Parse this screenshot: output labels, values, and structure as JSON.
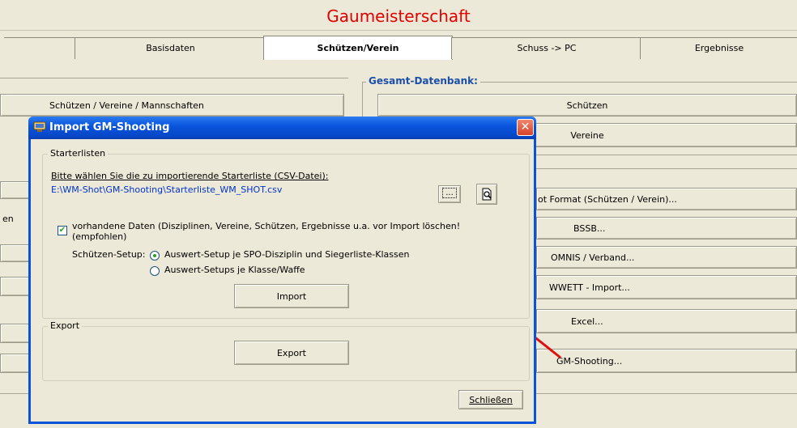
{
  "app": {
    "title": "Gaumeisterschaft",
    "tabs": [
      {
        "label": "Basisdaten"
      },
      {
        "label": "Schützen/Verein"
      },
      {
        "label": "Schuss -> PC"
      },
      {
        "label": "Ergebnisse"
      }
    ]
  },
  "left_panel": {
    "schuetzen_button": "Schützen / Vereine / Mannschaften",
    "partial_label": "en"
  },
  "right_panel": {
    "group_title": "Gesamt-Datenbank:",
    "buttons": {
      "schuetzen": "Schützen",
      "vereine": "Vereine",
      "format": "ot Format (Schützen / Verein)...",
      "bssb": "BSSB...",
      "omnis": "OMNIS / Verband...",
      "wwett": "WWETT - Import...",
      "excel": "Excel...",
      "gm_shooting": "GM-Shooting..."
    }
  },
  "dialog": {
    "title": "Import GM-Shooting",
    "close_glyph": "✕",
    "starterlisten": {
      "legend": "Starterlisten",
      "prompt": "Bitte wählen Sie die zu importierende Starterliste (CSV-Datei):",
      "path": "E:\\WM-Shot\\GM-Shooting\\Starterliste_WM_SHOT.csv",
      "browse_label": "...",
      "delete_checkbox": {
        "checked": true,
        "line1": "vorhandene Daten (Disziplinen, Vereine, Schützen, Ergebnisse u.a. vor Import löschen!",
        "line2": "(empfohlen)"
      },
      "setup_label": "Schützen-Setup:",
      "radio_options": [
        {
          "label": "Auswert-Setup je SPO-Disziplin und Siegerliste-Klassen",
          "selected": true
        },
        {
          "label": "Auswert-Setups je Klasse/Waffe",
          "selected": false
        }
      ],
      "import_button": "Import"
    },
    "export": {
      "legend": "Export",
      "export_button": "Export"
    },
    "close_button": "Schließen"
  },
  "colors": {
    "title_red": "#e00000",
    "group_title_blue": "#1d4fa8",
    "link_blue": "#0033cc",
    "dialog_title_blue": "#0a56dd",
    "arrow_red": "#e01010"
  }
}
